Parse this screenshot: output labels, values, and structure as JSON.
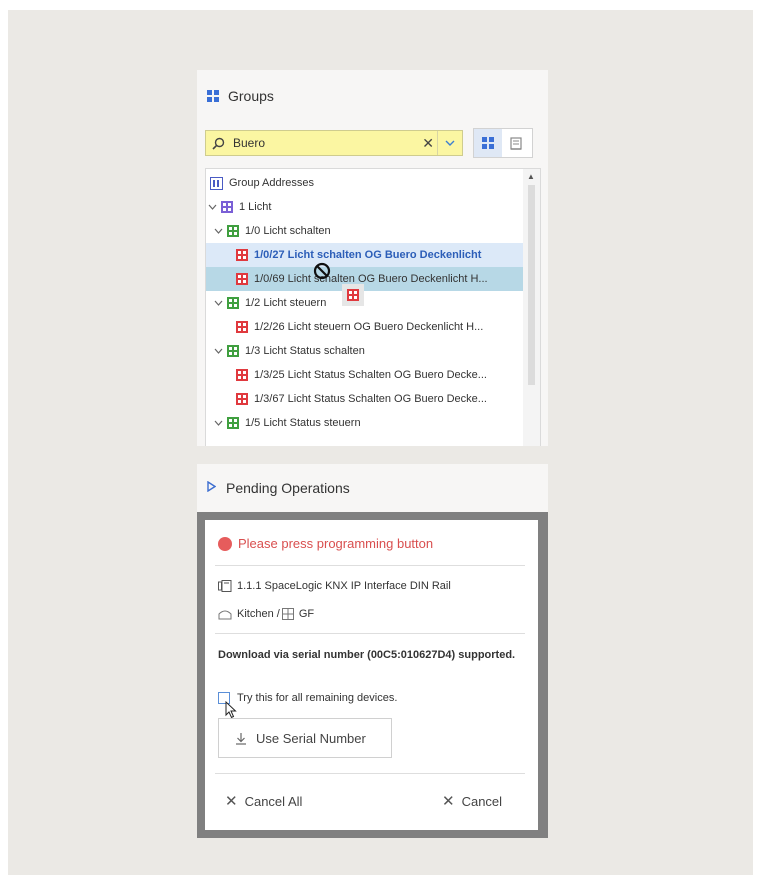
{
  "groups_panel": {
    "title": "Groups",
    "search": {
      "value": "Buero",
      "clear_glyph": "✕",
      "dropdown_glyph": "⌄"
    },
    "tree": [
      {
        "label": "Group Addresses",
        "icon": "group-addresses-icon",
        "level": "root"
      },
      {
        "label": "1 Licht",
        "icon": "main-group-icon",
        "level": "main"
      },
      {
        "label": "1/0 Licht schalten",
        "icon": "middle-group-icon",
        "level": "middle"
      },
      {
        "label": "1/0/27 Licht schalten OG Buero Deckenlicht",
        "icon": "group-address-icon",
        "level": "address",
        "state": "selected"
      },
      {
        "label": "1/0/69 Licht schalten OG Buero Deckenlicht H...",
        "icon": "group-address-icon",
        "level": "address",
        "state": "hover"
      },
      {
        "label": "1/2 Licht steuern",
        "icon": "middle-group-icon",
        "level": "middle"
      },
      {
        "label": "1/2/26 Licht steuern OG Buero Deckenlicht H...",
        "icon": "group-address-icon",
        "level": "address"
      },
      {
        "label": "1/3 Licht Status schalten",
        "icon": "middle-group-icon",
        "level": "middle"
      },
      {
        "label": "1/3/25 Licht Status Schalten OG Buero Decke...",
        "icon": "group-address-icon",
        "level": "address"
      },
      {
        "label": "1/3/67 Licht Status Schalten OG Buero Decke...",
        "icon": "group-address-icon",
        "level": "address"
      },
      {
        "label": "1/5 Licht Status steuern",
        "icon": "middle-group-icon",
        "level": "middle"
      }
    ]
  },
  "pending_panel": {
    "title": "Pending Operations"
  },
  "dialog": {
    "status": "Please press programming button",
    "device": "1.1.1 SpaceLogic KNX IP Interface DIN Rail",
    "location": "Kitchen / ",
    "location_floor": "GF",
    "message": "Download via serial number (00C5:010627D4) supported.",
    "checkbox_label": "Try this for all remaining devices.",
    "use_serial_label": "Use Serial Number",
    "cancel_all_label": "Cancel All",
    "cancel_label": "Cancel"
  },
  "colors": {
    "search_bg": "#fbf6a2",
    "selected_row_bg": "#dce9f8",
    "hover_row_bg": "#b7d8e6",
    "status_red": "#d94f4f",
    "accent_blue": "#3d7fd0"
  }
}
